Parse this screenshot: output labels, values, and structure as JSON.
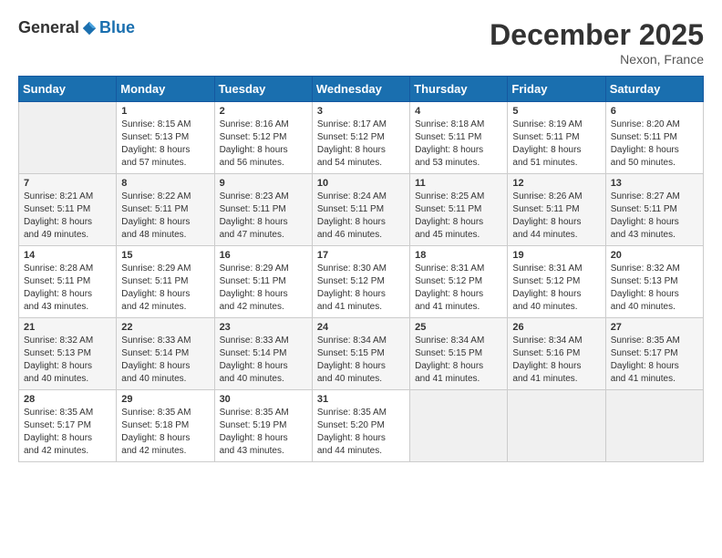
{
  "logo": {
    "general": "General",
    "blue": "Blue"
  },
  "title": "December 2025",
  "location": "Nexon, France",
  "days_of_week": [
    "Sunday",
    "Monday",
    "Tuesday",
    "Wednesday",
    "Thursday",
    "Friday",
    "Saturday"
  ],
  "weeks": [
    [
      {
        "day": "",
        "content": ""
      },
      {
        "day": "1",
        "content": "Sunrise: 8:15 AM\nSunset: 5:13 PM\nDaylight: 8 hours\nand 57 minutes."
      },
      {
        "day": "2",
        "content": "Sunrise: 8:16 AM\nSunset: 5:12 PM\nDaylight: 8 hours\nand 56 minutes."
      },
      {
        "day": "3",
        "content": "Sunrise: 8:17 AM\nSunset: 5:12 PM\nDaylight: 8 hours\nand 54 minutes."
      },
      {
        "day": "4",
        "content": "Sunrise: 8:18 AM\nSunset: 5:11 PM\nDaylight: 8 hours\nand 53 minutes."
      },
      {
        "day": "5",
        "content": "Sunrise: 8:19 AM\nSunset: 5:11 PM\nDaylight: 8 hours\nand 51 minutes."
      },
      {
        "day": "6",
        "content": "Sunrise: 8:20 AM\nSunset: 5:11 PM\nDaylight: 8 hours\nand 50 minutes."
      }
    ],
    [
      {
        "day": "7",
        "content": "Sunrise: 8:21 AM\nSunset: 5:11 PM\nDaylight: 8 hours\nand 49 minutes."
      },
      {
        "day": "8",
        "content": "Sunrise: 8:22 AM\nSunset: 5:11 PM\nDaylight: 8 hours\nand 48 minutes."
      },
      {
        "day": "9",
        "content": "Sunrise: 8:23 AM\nSunset: 5:11 PM\nDaylight: 8 hours\nand 47 minutes."
      },
      {
        "day": "10",
        "content": "Sunrise: 8:24 AM\nSunset: 5:11 PM\nDaylight: 8 hours\nand 46 minutes."
      },
      {
        "day": "11",
        "content": "Sunrise: 8:25 AM\nSunset: 5:11 PM\nDaylight: 8 hours\nand 45 minutes."
      },
      {
        "day": "12",
        "content": "Sunrise: 8:26 AM\nSunset: 5:11 PM\nDaylight: 8 hours\nand 44 minutes."
      },
      {
        "day": "13",
        "content": "Sunrise: 8:27 AM\nSunset: 5:11 PM\nDaylight: 8 hours\nand 43 minutes."
      }
    ],
    [
      {
        "day": "14",
        "content": "Sunrise: 8:28 AM\nSunset: 5:11 PM\nDaylight: 8 hours\nand 43 minutes."
      },
      {
        "day": "15",
        "content": "Sunrise: 8:29 AM\nSunset: 5:11 PM\nDaylight: 8 hours\nand 42 minutes."
      },
      {
        "day": "16",
        "content": "Sunrise: 8:29 AM\nSunset: 5:11 PM\nDaylight: 8 hours\nand 42 minutes."
      },
      {
        "day": "17",
        "content": "Sunrise: 8:30 AM\nSunset: 5:12 PM\nDaylight: 8 hours\nand 41 minutes."
      },
      {
        "day": "18",
        "content": "Sunrise: 8:31 AM\nSunset: 5:12 PM\nDaylight: 8 hours\nand 41 minutes."
      },
      {
        "day": "19",
        "content": "Sunrise: 8:31 AM\nSunset: 5:12 PM\nDaylight: 8 hours\nand 40 minutes."
      },
      {
        "day": "20",
        "content": "Sunrise: 8:32 AM\nSunset: 5:13 PM\nDaylight: 8 hours\nand 40 minutes."
      }
    ],
    [
      {
        "day": "21",
        "content": "Sunrise: 8:32 AM\nSunset: 5:13 PM\nDaylight: 8 hours\nand 40 minutes."
      },
      {
        "day": "22",
        "content": "Sunrise: 8:33 AM\nSunset: 5:14 PM\nDaylight: 8 hours\nand 40 minutes."
      },
      {
        "day": "23",
        "content": "Sunrise: 8:33 AM\nSunset: 5:14 PM\nDaylight: 8 hours\nand 40 minutes."
      },
      {
        "day": "24",
        "content": "Sunrise: 8:34 AM\nSunset: 5:15 PM\nDaylight: 8 hours\nand 40 minutes."
      },
      {
        "day": "25",
        "content": "Sunrise: 8:34 AM\nSunset: 5:15 PM\nDaylight: 8 hours\nand 41 minutes."
      },
      {
        "day": "26",
        "content": "Sunrise: 8:34 AM\nSunset: 5:16 PM\nDaylight: 8 hours\nand 41 minutes."
      },
      {
        "day": "27",
        "content": "Sunrise: 8:35 AM\nSunset: 5:17 PM\nDaylight: 8 hours\nand 41 minutes."
      }
    ],
    [
      {
        "day": "28",
        "content": "Sunrise: 8:35 AM\nSunset: 5:17 PM\nDaylight: 8 hours\nand 42 minutes."
      },
      {
        "day": "29",
        "content": "Sunrise: 8:35 AM\nSunset: 5:18 PM\nDaylight: 8 hours\nand 42 minutes."
      },
      {
        "day": "30",
        "content": "Sunrise: 8:35 AM\nSunset: 5:19 PM\nDaylight: 8 hours\nand 43 minutes."
      },
      {
        "day": "31",
        "content": "Sunrise: 8:35 AM\nSunset: 5:20 PM\nDaylight: 8 hours\nand 44 minutes."
      },
      {
        "day": "",
        "content": ""
      },
      {
        "day": "",
        "content": ""
      },
      {
        "day": "",
        "content": ""
      }
    ]
  ]
}
